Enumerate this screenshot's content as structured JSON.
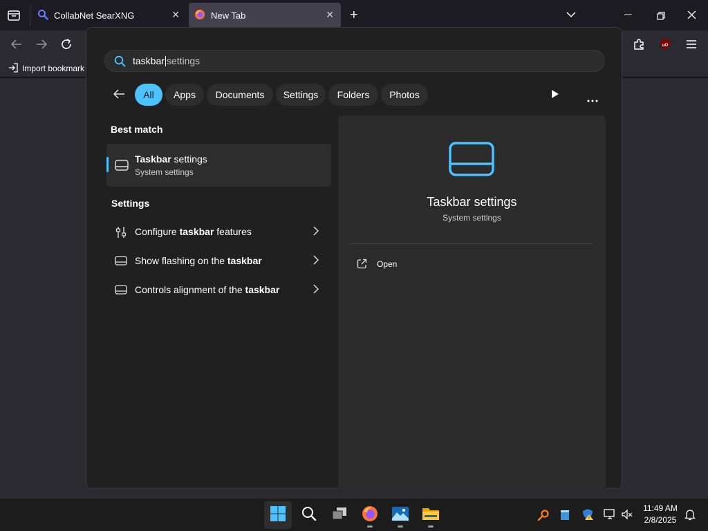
{
  "browser": {
    "tabs": [
      {
        "title": "CollabNet SearXNG"
      },
      {
        "title": "New Tab"
      }
    ],
    "bookmarks": {
      "import_label": "Import bookmark"
    }
  },
  "search": {
    "typed": "taskbar",
    "suggestion": " settings"
  },
  "filters": [
    {
      "label": "All"
    },
    {
      "label": "Apps"
    },
    {
      "label": "Documents"
    },
    {
      "label": "Settings"
    },
    {
      "label": "Folders"
    },
    {
      "label": "Photos"
    }
  ],
  "best_match": {
    "section": "Best match",
    "title_bold": "Taskbar",
    "title_rest": " settings",
    "subtitle": "System settings"
  },
  "settings": {
    "section": "Settings",
    "items": [
      {
        "pre": "Configure ",
        "bold": "taskbar",
        "post": " features"
      },
      {
        "pre": "Show flashing on the ",
        "bold": "taskbar",
        "post": ""
      },
      {
        "pre": "Controls alignment of the ",
        "bold": "taskbar",
        "post": ""
      }
    ]
  },
  "preview": {
    "title": "Taskbar settings",
    "subtitle": "System settings",
    "open_label": "Open"
  },
  "taskbar": {
    "time": "11:49 AM",
    "date": "2/8/2025"
  },
  "colors": {
    "accent": "#4cc2ff",
    "flyout_bg": "#202020",
    "preview_bg": "#2b2b2b"
  }
}
